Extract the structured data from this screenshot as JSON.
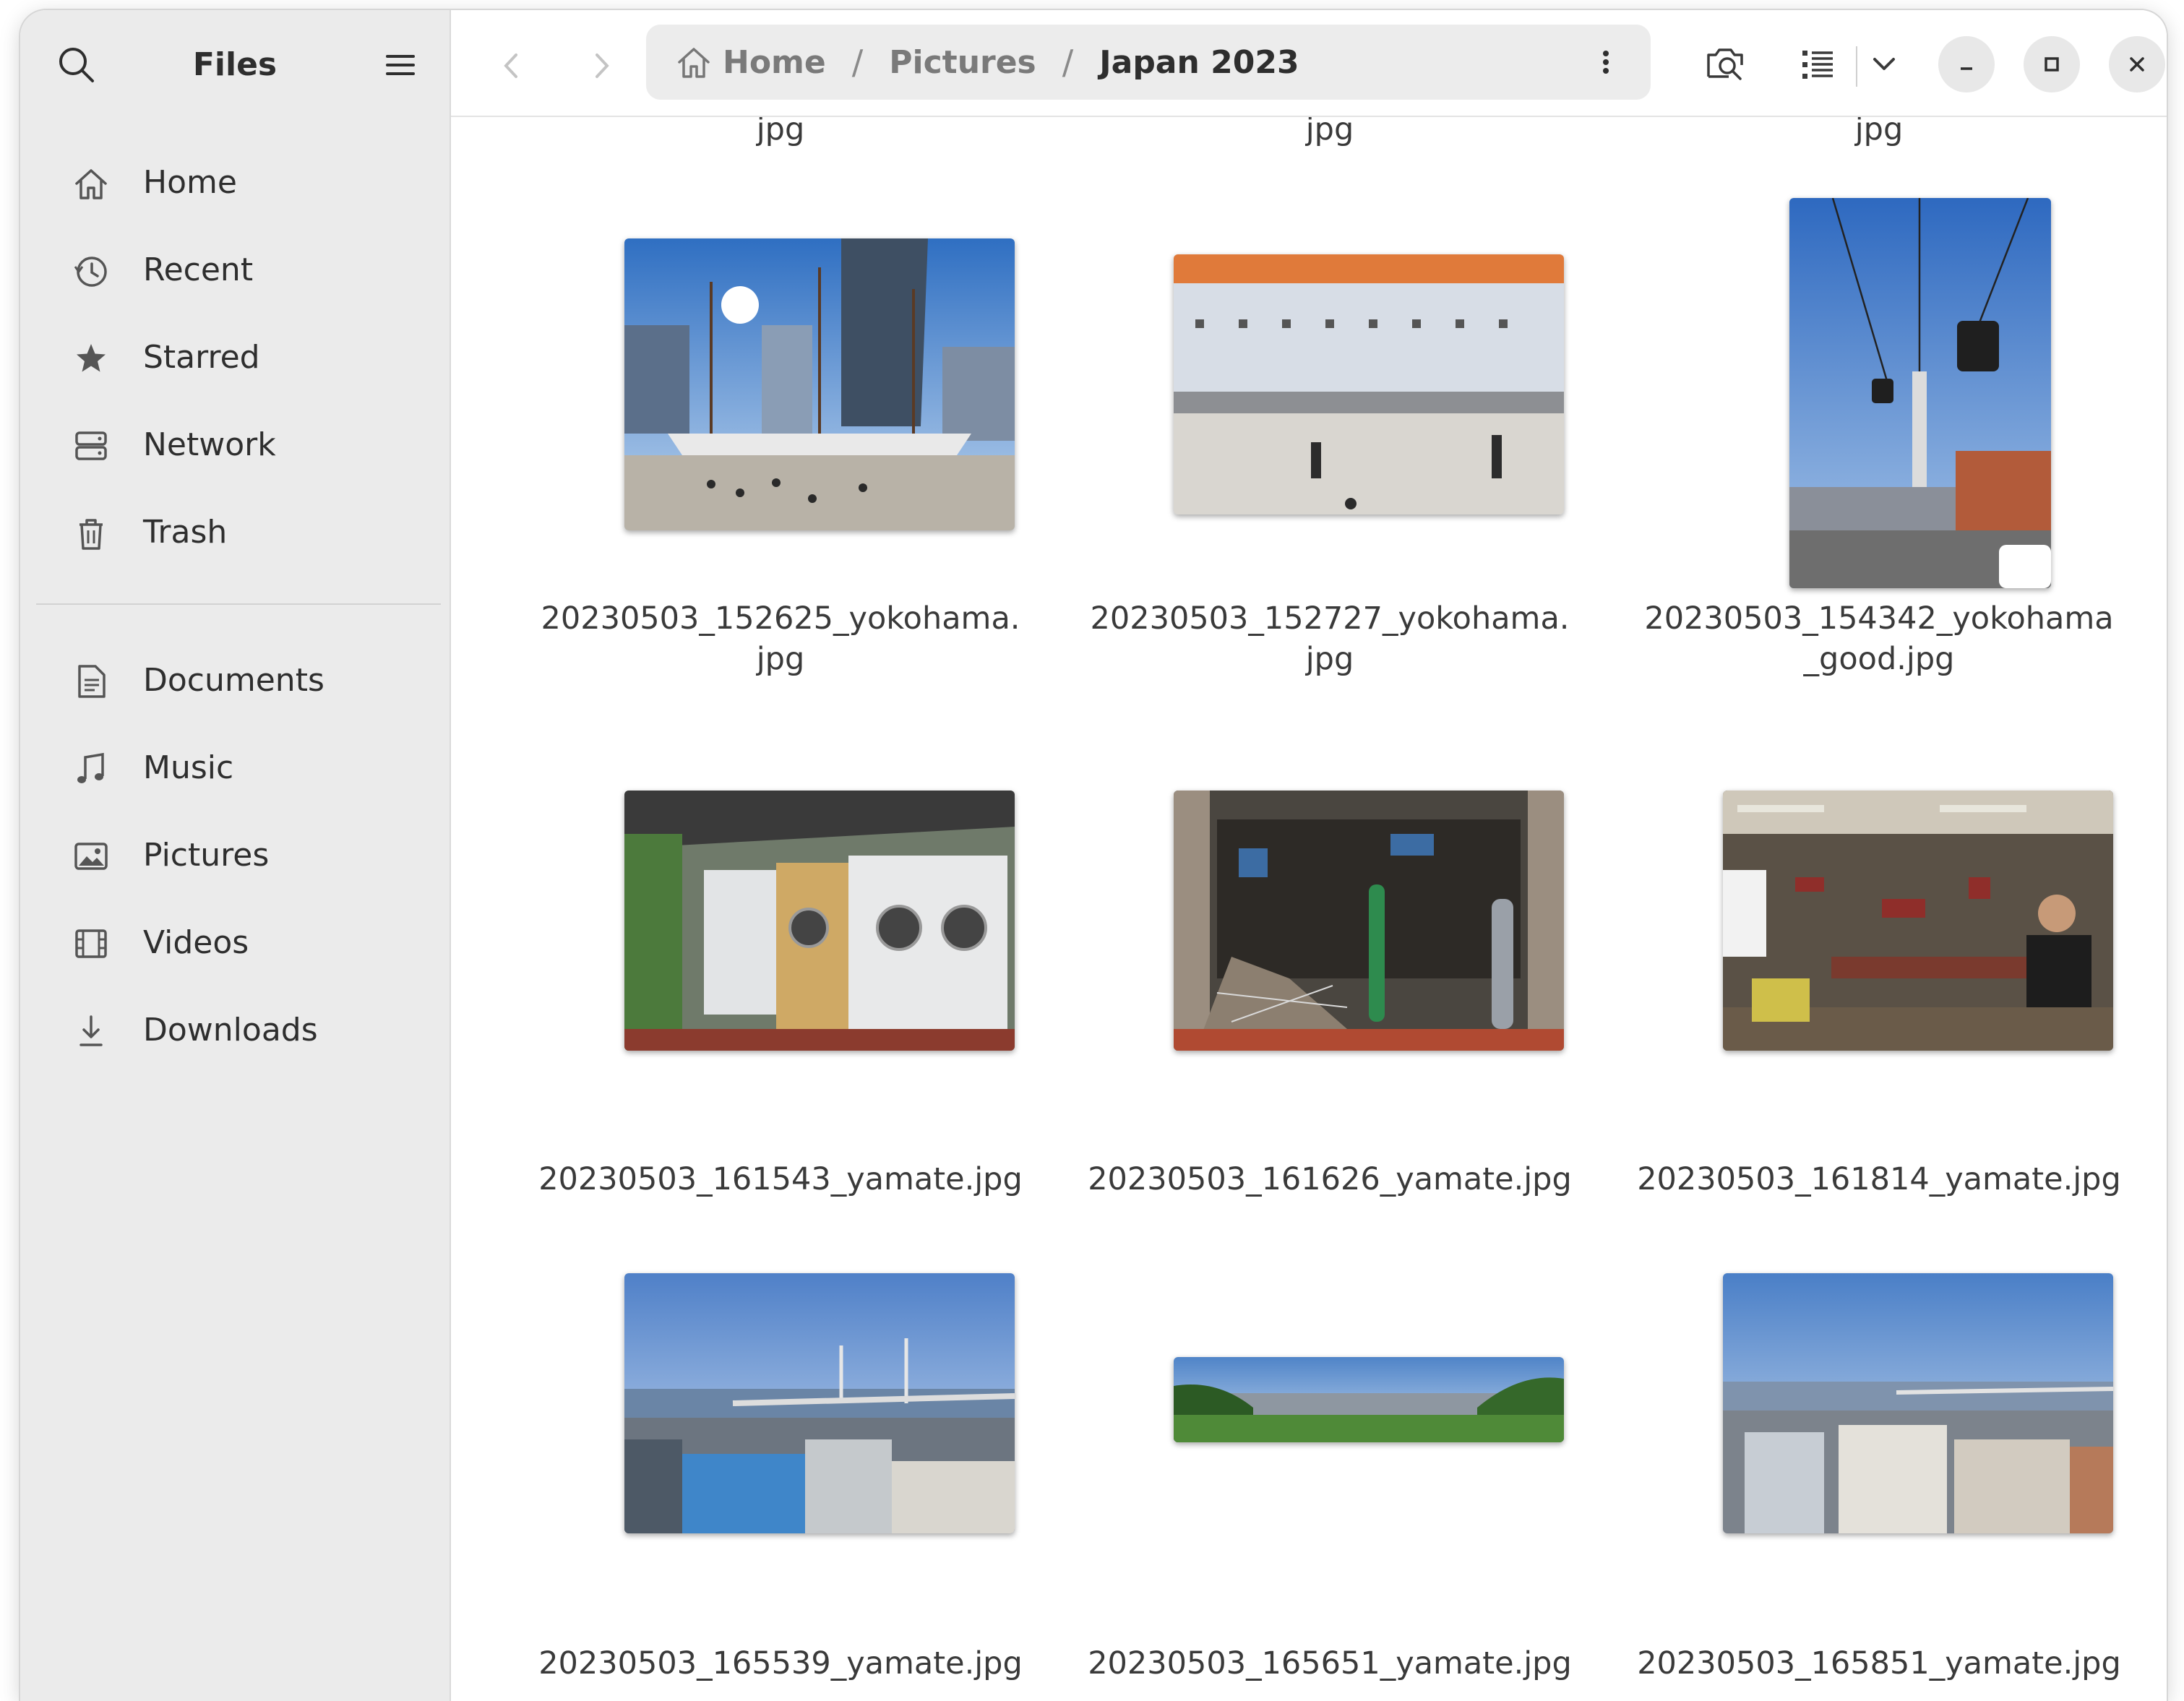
{
  "app": {
    "title": "Files"
  },
  "sidebar": {
    "places": [
      {
        "label": "Home",
        "icon": "home-icon"
      },
      {
        "label": "Recent",
        "icon": "recent-icon"
      },
      {
        "label": "Starred",
        "icon": "star-icon"
      },
      {
        "label": "Network",
        "icon": "network-icon"
      },
      {
        "label": "Trash",
        "icon": "trash-icon"
      }
    ],
    "folders": [
      {
        "label": "Documents",
        "icon": "document-icon"
      },
      {
        "label": "Music",
        "icon": "music-icon"
      },
      {
        "label": "Pictures",
        "icon": "pictures-icon"
      },
      {
        "label": "Videos",
        "icon": "video-icon"
      },
      {
        "label": "Downloads",
        "icon": "download-icon"
      }
    ]
  },
  "pathbar": {
    "crumbs": [
      "Home",
      "Pictures",
      "Japan 2023"
    ],
    "separator": "/"
  },
  "files": {
    "partial_row": [
      "jpg",
      "jpg",
      "jpg"
    ],
    "rows": [
      [
        {
          "name": "20230503_152625_yokohama.\njpg"
        },
        {
          "name": "20230503_152727_yokohama.\njpg"
        },
        {
          "name": "20230503_154342_yokohama\n_good.jpg"
        }
      ],
      [
        {
          "name": "20230503_161543_yamate.jpg"
        },
        {
          "name": "20230503_161626_yamate.jpg"
        },
        {
          "name": "20230503_161814_yamate.jpg"
        }
      ],
      [
        {
          "name": "20230503_165539_yamate.jpg"
        },
        {
          "name": "20230503_165651_yamate.jpg"
        },
        {
          "name": "20230503_165851_yamate.jpg"
        }
      ]
    ]
  },
  "colors": {
    "sidebar_bg": "#ebebeb",
    "pathbar_bg": "#ececec",
    "accent_text": "#2e2e2e"
  }
}
